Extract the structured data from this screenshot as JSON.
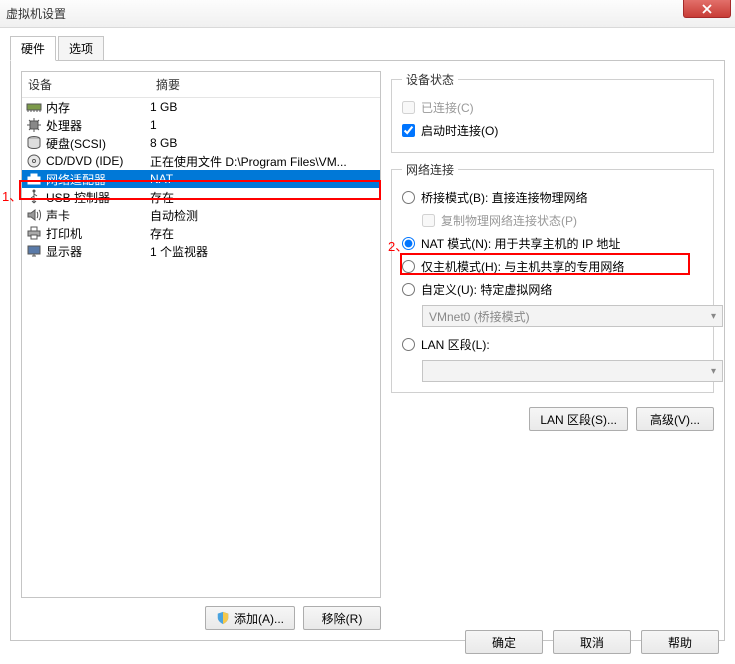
{
  "title": "虚拟机设置",
  "tabs": {
    "hardware": "硬件",
    "options": "选项"
  },
  "list_header": {
    "device": "设备",
    "summary": "摘要"
  },
  "hardware": [
    {
      "name": "内存",
      "summary": "1 GB",
      "icon": "memory"
    },
    {
      "name": "处理器",
      "summary": "1",
      "icon": "cpu"
    },
    {
      "name": "硬盘(SCSI)",
      "summary": "8 GB",
      "icon": "hdd"
    },
    {
      "name": "CD/DVD (IDE)",
      "summary": "正在使用文件 D:\\Program Files\\VM...",
      "icon": "cd"
    },
    {
      "name": "网络适配器",
      "summary": "NAT",
      "icon": "net",
      "selected": true
    },
    {
      "name": "USB 控制器",
      "summary": "存在",
      "icon": "usb"
    },
    {
      "name": "声卡",
      "summary": "自动检测",
      "icon": "sound"
    },
    {
      "name": "打印机",
      "summary": "存在",
      "icon": "printer"
    },
    {
      "name": "显示器",
      "summary": "1 个监视器",
      "icon": "display"
    }
  ],
  "left_buttons": {
    "add": "添加(A)...",
    "remove": "移除(R)"
  },
  "device_state": {
    "legend": "设备状态",
    "connected": "已连接(C)",
    "connected_checked": false,
    "connect_at_power_on": "启动时连接(O)",
    "connect_at_power_on_checked": true
  },
  "network": {
    "legend": "网络连接",
    "bridged": "桥接模式(B): 直接连接物理网络",
    "replicate": "复制物理网络连接状态(P)",
    "nat": "NAT 模式(N): 用于共享主机的 IP 地址",
    "hostonly": "仅主机模式(H): 与主机共享的专用网络",
    "custom": "自定义(U): 特定虚拟网络",
    "custom_combo": "VMnet0 (桥接模式)",
    "lan_segment": "LAN 区段(L):",
    "lan_combo": ""
  },
  "right_buttons": {
    "lan_segments": "LAN 区段(S)...",
    "advanced": "高级(V)..."
  },
  "footer": {
    "ok": "确定",
    "cancel": "取消",
    "help": "帮助"
  },
  "annotations": {
    "n1": "1、",
    "n2": "2、"
  }
}
